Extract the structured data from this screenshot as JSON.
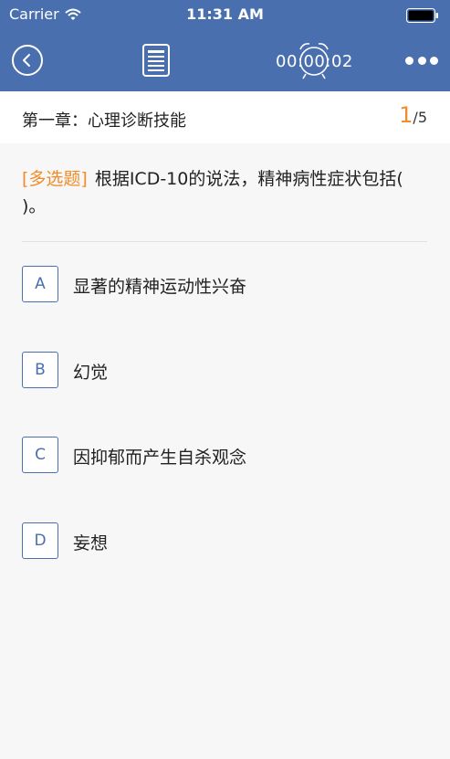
{
  "status": {
    "carrier": "Carrier",
    "time": "11:31 AM"
  },
  "nav": {
    "timer": "00:00:02"
  },
  "chapter": {
    "title": "第一章：心理诊断技能",
    "current": "1",
    "total": "/5"
  },
  "question": {
    "type": "[多选题]",
    "text": "根据ICD-10的说法，精神病性症状包括(    )。"
  },
  "options": [
    {
      "letter": "A",
      "text": "显著的精神运动性兴奋"
    },
    {
      "letter": "B",
      "text": "幻觉"
    },
    {
      "letter": "C",
      "text": "因抑郁而产生自杀观念"
    },
    {
      "letter": "D",
      "text": "妄想"
    }
  ],
  "colors": {
    "nav_bg": "#4a6fae",
    "accent": "#f28c28",
    "option_border": "#4a6fae"
  },
  "icons": [
    "wifi-icon",
    "battery-icon",
    "back-icon",
    "document-icon",
    "alarm-clock-icon",
    "more-icon"
  ]
}
